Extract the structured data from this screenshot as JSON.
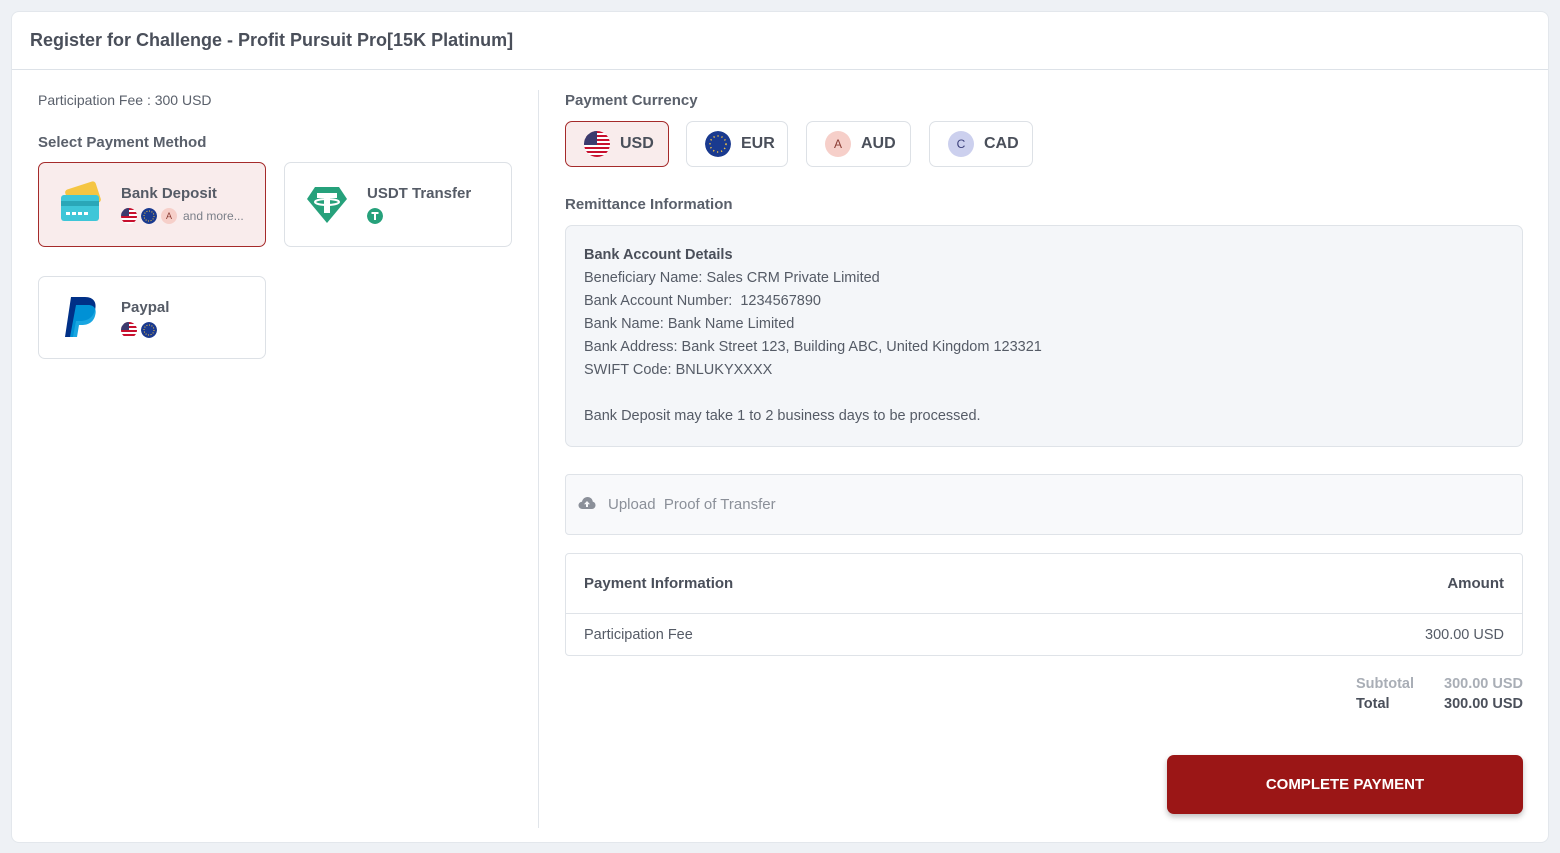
{
  "header": {
    "title": "Register for Challenge - Profit Pursuit Pro[15K Platinum]"
  },
  "left": {
    "participation_fee": "Participation Fee : 300 USD",
    "select_method_title": "Select Payment Method",
    "methods": [
      {
        "name": "Bank Deposit",
        "icon": "credit-card-icon",
        "more": "and more..."
      },
      {
        "name": "USDT Transfer",
        "icon": "tether-icon"
      },
      {
        "name": "Paypal",
        "icon": "paypal-icon"
      }
    ]
  },
  "right": {
    "currency_title": "Payment Currency",
    "currencies": [
      {
        "code": "USD",
        "icon": "us-flag-icon"
      },
      {
        "code": "EUR",
        "icon": "eu-flag-icon"
      },
      {
        "code": "AUD",
        "letter": "A"
      },
      {
        "code": "CAD",
        "letter": "C"
      }
    ],
    "remittance_title": "Remittance Information",
    "remittance": {
      "heading": "Bank Account Details",
      "beneficiary": "Beneficiary Name: Sales CRM Private Limited",
      "account_number": "Bank Account Number:  1234567890",
      "bank_name": "Bank Name: Bank Name Limited",
      "bank_address": "Bank Address: Bank Street 123, Building ABC, United Kingdom 123321",
      "swift": "SWIFT Code: BNLUKYXXXX",
      "note": "Bank Deposit may take 1 to 2 business days to be processed."
    },
    "upload_label": "Upload  Proof of Transfer",
    "payment_table": {
      "col_info": "Payment Information",
      "col_amount": "Amount",
      "rows": [
        {
          "label": "Participation Fee",
          "amount": "300.00 USD"
        }
      ]
    },
    "subtotal_label": "Subtotal",
    "subtotal_value": "300.00 USD",
    "total_label": "Total",
    "total_value": "300.00 USD",
    "complete_button": "COMPLETE PAYMENT"
  },
  "colors": {
    "accent": "#9b1616",
    "active_bg": "#f9ecec",
    "tether": "#26a17b",
    "paypal_dark": "#003087",
    "paypal_light": "#009cde"
  }
}
